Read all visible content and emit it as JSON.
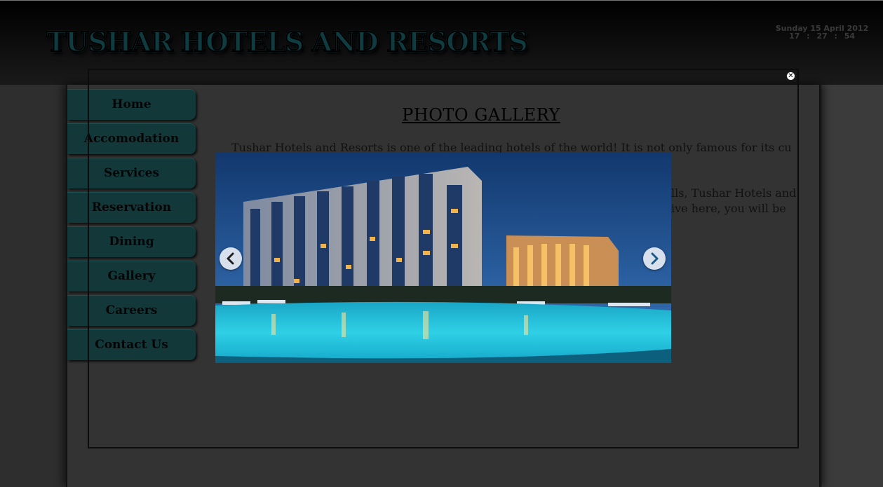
{
  "header": {
    "site_title": "TUSHAR HOTELS AND RESORTS",
    "date": "Sunday 15 April 2012",
    "time": "17 : 27 : 54"
  },
  "nav": {
    "items": [
      {
        "label": "Home"
      },
      {
        "label": "Accomodation"
      },
      {
        "label": "Services"
      },
      {
        "label": "Reservation"
      },
      {
        "label": "Dining"
      },
      {
        "label": "Gallery"
      },
      {
        "label": "Careers"
      },
      {
        "label": "Contact Us"
      }
    ]
  },
  "main": {
    "heading": "PHOTO GALLERY",
    "intro_line_1": "Tushar Hotels and Resorts is one of the leading hotels of the world! It is not only famous for its cultural",
    "intro_frag_1": "lls, Tushar Hotels and",
    "intro_frag_2": "ive here, you will be"
  },
  "lightbox": {
    "close_icon": "close-icon",
    "prev_icon": "chevron-left-icon",
    "next_icon": "chevron-right-icon",
    "image_subject": "hotel-pool-night-photo"
  },
  "colors": {
    "nav_bg": "#12383a",
    "title_fill": "#0f3c41",
    "page_bg": "#2f2f2f"
  }
}
